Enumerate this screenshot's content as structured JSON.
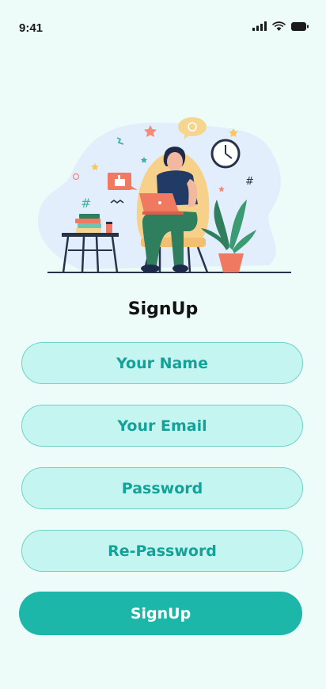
{
  "status_bar": {
    "time": "9:41"
  },
  "form": {
    "title": "SignUp",
    "fields": [
      {
        "placeholder": "Your Name"
      },
      {
        "placeholder": "Your Email"
      },
      {
        "placeholder": "Password"
      },
      {
        "placeholder": "Re-Password"
      }
    ],
    "submit_label": "SignUp"
  },
  "colors": {
    "background": "#edfcf9",
    "field_fill": "#c5f5f1",
    "field_border": "#6ed3c6",
    "field_text": "#14a298",
    "button": "#1db7a9",
    "button_text": "#ffffff"
  },
  "icons": [
    "cellular-signal-icon",
    "wifi-icon",
    "battery-icon"
  ]
}
